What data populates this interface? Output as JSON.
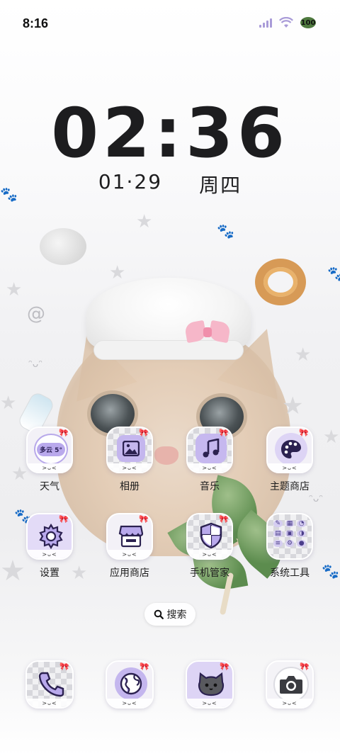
{
  "status_bar": {
    "time": "8:16",
    "battery_level": "100",
    "icons": [
      "signal-icon",
      "wifi-icon",
      "battery-icon"
    ]
  },
  "lockclock": {
    "time": "02:36",
    "date": "01·29",
    "weekday": "周四"
  },
  "apps": [
    {
      "id": "weather",
      "label": "天气",
      "icon": "weather-cloud-icon",
      "badge": "多云 5°"
    },
    {
      "id": "gallery",
      "label": "相册",
      "icon": "image-icon"
    },
    {
      "id": "music",
      "label": "音乐",
      "icon": "music-note-icon"
    },
    {
      "id": "theme-store",
      "label": "主题商店",
      "icon": "palette-icon"
    },
    {
      "id": "settings",
      "label": "设置",
      "icon": "gear-icon"
    },
    {
      "id": "app-store",
      "label": "应用商店",
      "icon": "store-icon"
    },
    {
      "id": "phone-manager",
      "label": "手机管家",
      "icon": "shield-icon"
    },
    {
      "id": "system-tools",
      "label": "系统工具",
      "icon": "folder-icon"
    }
  ],
  "icon_strip_text": ">ᴗ<",
  "search": {
    "label": "搜索"
  },
  "dock": [
    {
      "id": "phone",
      "icon": "phone-icon"
    },
    {
      "id": "browser",
      "icon": "globe-icon"
    },
    {
      "id": "messages",
      "icon": "cat-face-icon"
    },
    {
      "id": "camera",
      "icon": "camera-icon"
    }
  ],
  "colors": {
    "accent": "#b9a9ec",
    "ribbon": "#d23a68",
    "text": "#1d1d1f"
  }
}
